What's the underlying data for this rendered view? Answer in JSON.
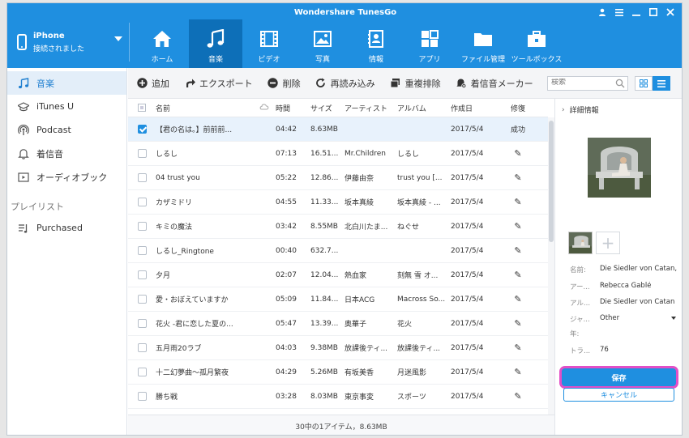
{
  "app": {
    "title": "Wondershare TunesGo"
  },
  "device": {
    "name": "iPhone",
    "status": "接続されました"
  },
  "nav": {
    "tabs": [
      {
        "label": "ホーム",
        "icon": "home-icon"
      },
      {
        "label": "音楽",
        "icon": "music-icon",
        "active": true
      },
      {
        "label": "ビデオ",
        "icon": "video-icon"
      },
      {
        "label": "写真",
        "icon": "photo-icon"
      },
      {
        "label": "情報",
        "icon": "contacts-icon"
      },
      {
        "label": "アプリ",
        "icon": "apps-icon"
      },
      {
        "label": "ファイル管理",
        "icon": "folder-icon"
      },
      {
        "label": "ツールボックス",
        "icon": "toolbox-icon"
      }
    ]
  },
  "sidebar": {
    "items": [
      {
        "label": "音楽",
        "icon": "music-note-icon",
        "active": true
      },
      {
        "label": "iTunes U",
        "icon": "graduation-cap-icon"
      },
      {
        "label": "Podcast",
        "icon": "podcast-icon"
      },
      {
        "label": "着信音",
        "icon": "bell-icon"
      },
      {
        "label": "オーディオブック",
        "icon": "audiobook-icon"
      }
    ],
    "playlist_header": "プレイリスト",
    "playlists": [
      {
        "label": "Purchased",
        "icon": "playlist-icon"
      }
    ]
  },
  "toolbar": {
    "add": "追加",
    "export": "エクスポート",
    "delete": "削除",
    "refresh": "再読み込み",
    "dedupe": "重複排除",
    "ringtone": "着信音メーカー",
    "search_placeholder": "検索"
  },
  "table": {
    "headers": {
      "name": "名前",
      "time": "時間",
      "size": "サイズ",
      "artist": "アーティスト",
      "album": "アルバム",
      "date": "作成日",
      "fix": "修復"
    },
    "rows": [
      {
        "name": "【君の名は。】前前前...",
        "time": "04:42",
        "size": "8.63MB",
        "artist": "",
        "album": "",
        "date": "2017/5/4",
        "fix": "成功",
        "checked": true
      },
      {
        "name": "しるし",
        "time": "07:13",
        "size": "16.51...",
        "artist": "Mr.Children",
        "album": "しるし",
        "date": "2017/5/4",
        "fix": "✎",
        "checked": false
      },
      {
        "name": "04 trust you",
        "time": "05:22",
        "size": "12.86...",
        "artist": "伊藤由奈",
        "album": "trust you [...",
        "date": "2017/5/4",
        "fix": "✎",
        "checked": false
      },
      {
        "name": "カザミドリ",
        "time": "04:55",
        "size": "11.33...",
        "artist": "坂本真綾",
        "album": "坂本真綾 - ...",
        "date": "2017/5/4",
        "fix": "✎",
        "checked": false
      },
      {
        "name": "キミの魔法",
        "time": "03:42",
        "size": "8.55MB",
        "artist": "北白川たま...",
        "album": "ねぐせ",
        "date": "2017/5/4",
        "fix": "✎",
        "checked": false
      },
      {
        "name": "しるし_Ringtone",
        "time": "00:40",
        "size": "632.7...",
        "artist": "",
        "album": "",
        "date": "2017/5/4",
        "fix": "✎",
        "checked": false
      },
      {
        "name": "夕月",
        "time": "02:07",
        "size": "12.04...",
        "artist": "熱血家",
        "album": "刻無 雪 オ...",
        "date": "2017/5/4",
        "fix": "✎",
        "checked": false
      },
      {
        "name": "愛・おぼえていますか",
        "time": "05:09",
        "size": "11.84...",
        "artist": "日本ACG",
        "album": "Macross So...",
        "date": "2017/5/4",
        "fix": "✎",
        "checked": false
      },
      {
        "name": "花火 -君に恋した夏の...",
        "time": "05:47",
        "size": "13.39...",
        "artist": "奥華子",
        "album": "花火",
        "date": "2017/5/4",
        "fix": "✎",
        "checked": false
      },
      {
        "name": "五月雨20ラブ",
        "time": "04:03",
        "size": "9.38MB",
        "artist": "放課後ティ...",
        "album": "放課後ティ...",
        "date": "2017/5/4",
        "fix": "✎",
        "checked": false
      },
      {
        "name": "十二幻夢曲～孤月繁夜",
        "time": "04:29",
        "size": "5.26MB",
        "artist": "有坂美香",
        "album": "月迷風影",
        "date": "2017/5/4",
        "fix": "✎",
        "checked": false
      },
      {
        "name": "勝ち戦",
        "time": "03:28",
        "size": "8.03MB",
        "artist": "東京事変",
        "album": "スポーツ",
        "date": "2017/5/4",
        "fix": "✎",
        "checked": false
      }
    ]
  },
  "status": {
    "text": "30中の1アイテム，8.63MB"
  },
  "detail": {
    "title": "詳細情報",
    "fields": [
      {
        "label": "名前:",
        "value": "Die Siedler von Catan, Kap"
      },
      {
        "label": "アー...",
        "value": "Rebecca Gablé"
      },
      {
        "label": "アル...",
        "value": "Die Siedler von Catan"
      },
      {
        "label": "ジャ...",
        "value": "Other",
        "dropdown": true
      },
      {
        "label": "年:",
        "value": ""
      },
      {
        "label": "トラ...",
        "value": "76"
      }
    ],
    "save": "保存",
    "cancel": "キャンセル"
  },
  "colors": {
    "accent": "#1f8fe0",
    "highlight": "#e24fc7",
    "nav_active": "#0d6fb8"
  }
}
